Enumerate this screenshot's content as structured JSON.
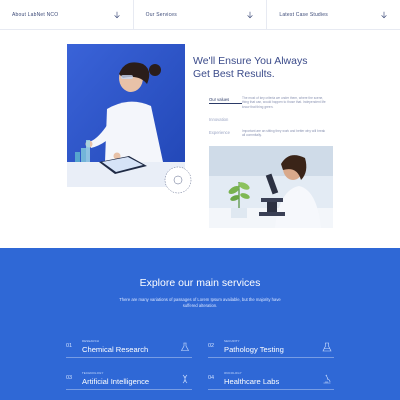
{
  "topnav": [
    {
      "label": "About LabNet NCO",
      "icon": "chevron-down-icon"
    },
    {
      "label": "Our Services",
      "icon": "chevron-down-icon"
    },
    {
      "label": "Latest Case Studies",
      "icon": "chevron-down-icon"
    }
  ],
  "hero": {
    "title_line1": "We'll Ensure You Always",
    "title_line2": "Get Best Results."
  },
  "tabs": [
    {
      "name": "Our values",
      "text": "The most of key criteria we under them, where the scene, thing that can, would happen to those that. Independent life know that thing green."
    },
    {
      "name": "Innovation",
      "text": ""
    },
    {
      "name": "Experience",
      "text": "Important are an sitting they work and better why will break all commitally."
    }
  ],
  "services": {
    "title": "Explore our main services",
    "subtitle": "There are many variations of passages of Lorem Ipsum available, but the majority have suffered alteration.",
    "items": [
      {
        "num": "01",
        "tag": "RESEARCH",
        "name": "Chemical Research",
        "icon": "flask-icon"
      },
      {
        "num": "02",
        "tag": "SECURITY",
        "name": "Pathology Testing",
        "icon": "beaker-icon"
      },
      {
        "num": "03",
        "tag": "TECHNOLOGY",
        "name": "Artificial Intelligence",
        "icon": "dna-icon"
      },
      {
        "num": "04",
        "tag": "ONCOLOGY",
        "name": "Healthcare Labs",
        "icon": "microscope-icon"
      }
    ]
  },
  "colors": {
    "primary_blue": "#2f68d6",
    "heading_navy": "#3b4b8a"
  }
}
